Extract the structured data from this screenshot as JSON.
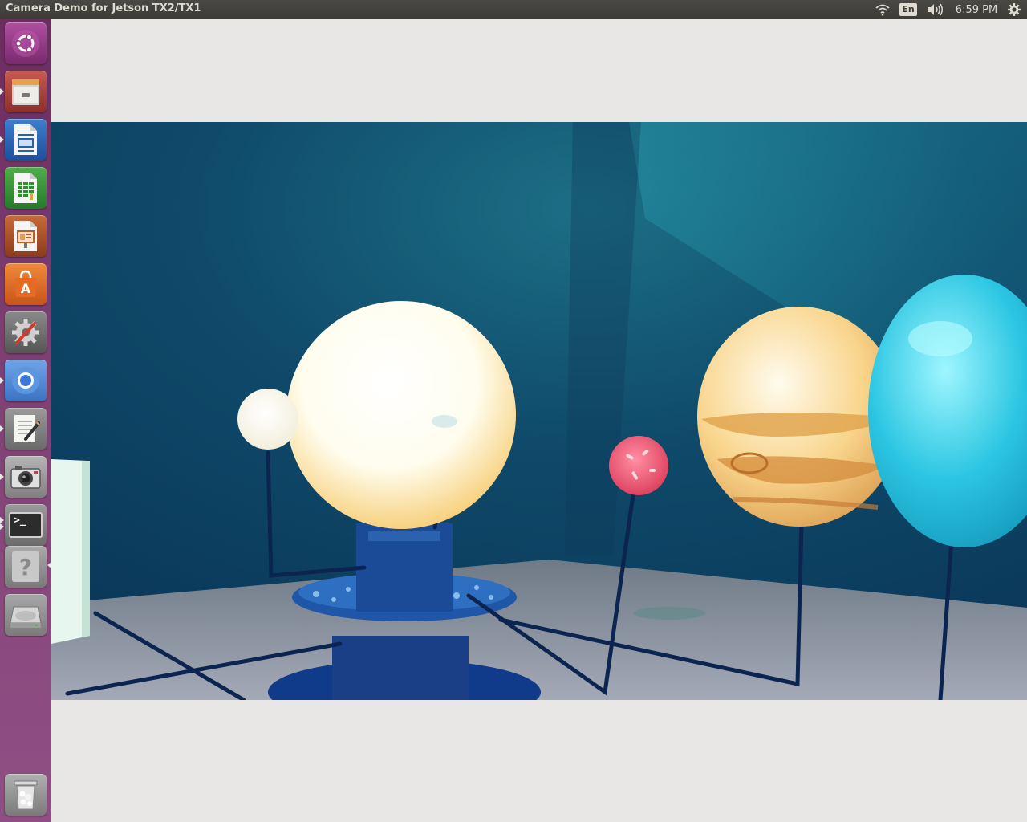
{
  "window": {
    "title": "Camera Demo for Jetson TX2/TX1"
  },
  "panel": {
    "indicators": {
      "wifi_icon": "wifi-icon",
      "language": "En",
      "sound_icon": "volume-icon",
      "clock": "6:59 PM",
      "session_icon": "gear-icon"
    }
  },
  "launcher": {
    "items": [
      {
        "name": "ubuntu-dash",
        "icon": "ubuntu-logo-icon"
      },
      {
        "name": "files",
        "icon": "file-cabinet-icon",
        "running": true
      },
      {
        "name": "libreoffice-writer",
        "icon": "document-icon",
        "running": true
      },
      {
        "name": "libreoffice-calc",
        "icon": "spreadsheet-icon"
      },
      {
        "name": "libreoffice-impress",
        "icon": "presentation-icon"
      },
      {
        "name": "software-center",
        "icon": "shopping-bag-icon",
        "glyph": "A"
      },
      {
        "name": "system-settings",
        "icon": "wrench-gear-icon"
      },
      {
        "name": "chromium",
        "icon": "chromium-icon",
        "running": true
      },
      {
        "name": "text-editor",
        "icon": "notepad-icon",
        "running": true
      },
      {
        "name": "camera-app",
        "icon": "camera-icon",
        "running": true
      },
      {
        "name": "terminal",
        "icon": "terminal-icon",
        "glyph": ">_",
        "running": true
      },
      {
        "name": "help",
        "icon": "question-icon",
        "glyph": "?",
        "active": true
      },
      {
        "name": "disk",
        "icon": "drive-icon"
      },
      {
        "name": "trash",
        "icon": "trash-icon"
      }
    ]
  },
  "colors": {
    "panel_bg": "#3c3b37",
    "launcher_bg": "#7d3f72",
    "window_bg": "#e8e7e5"
  }
}
